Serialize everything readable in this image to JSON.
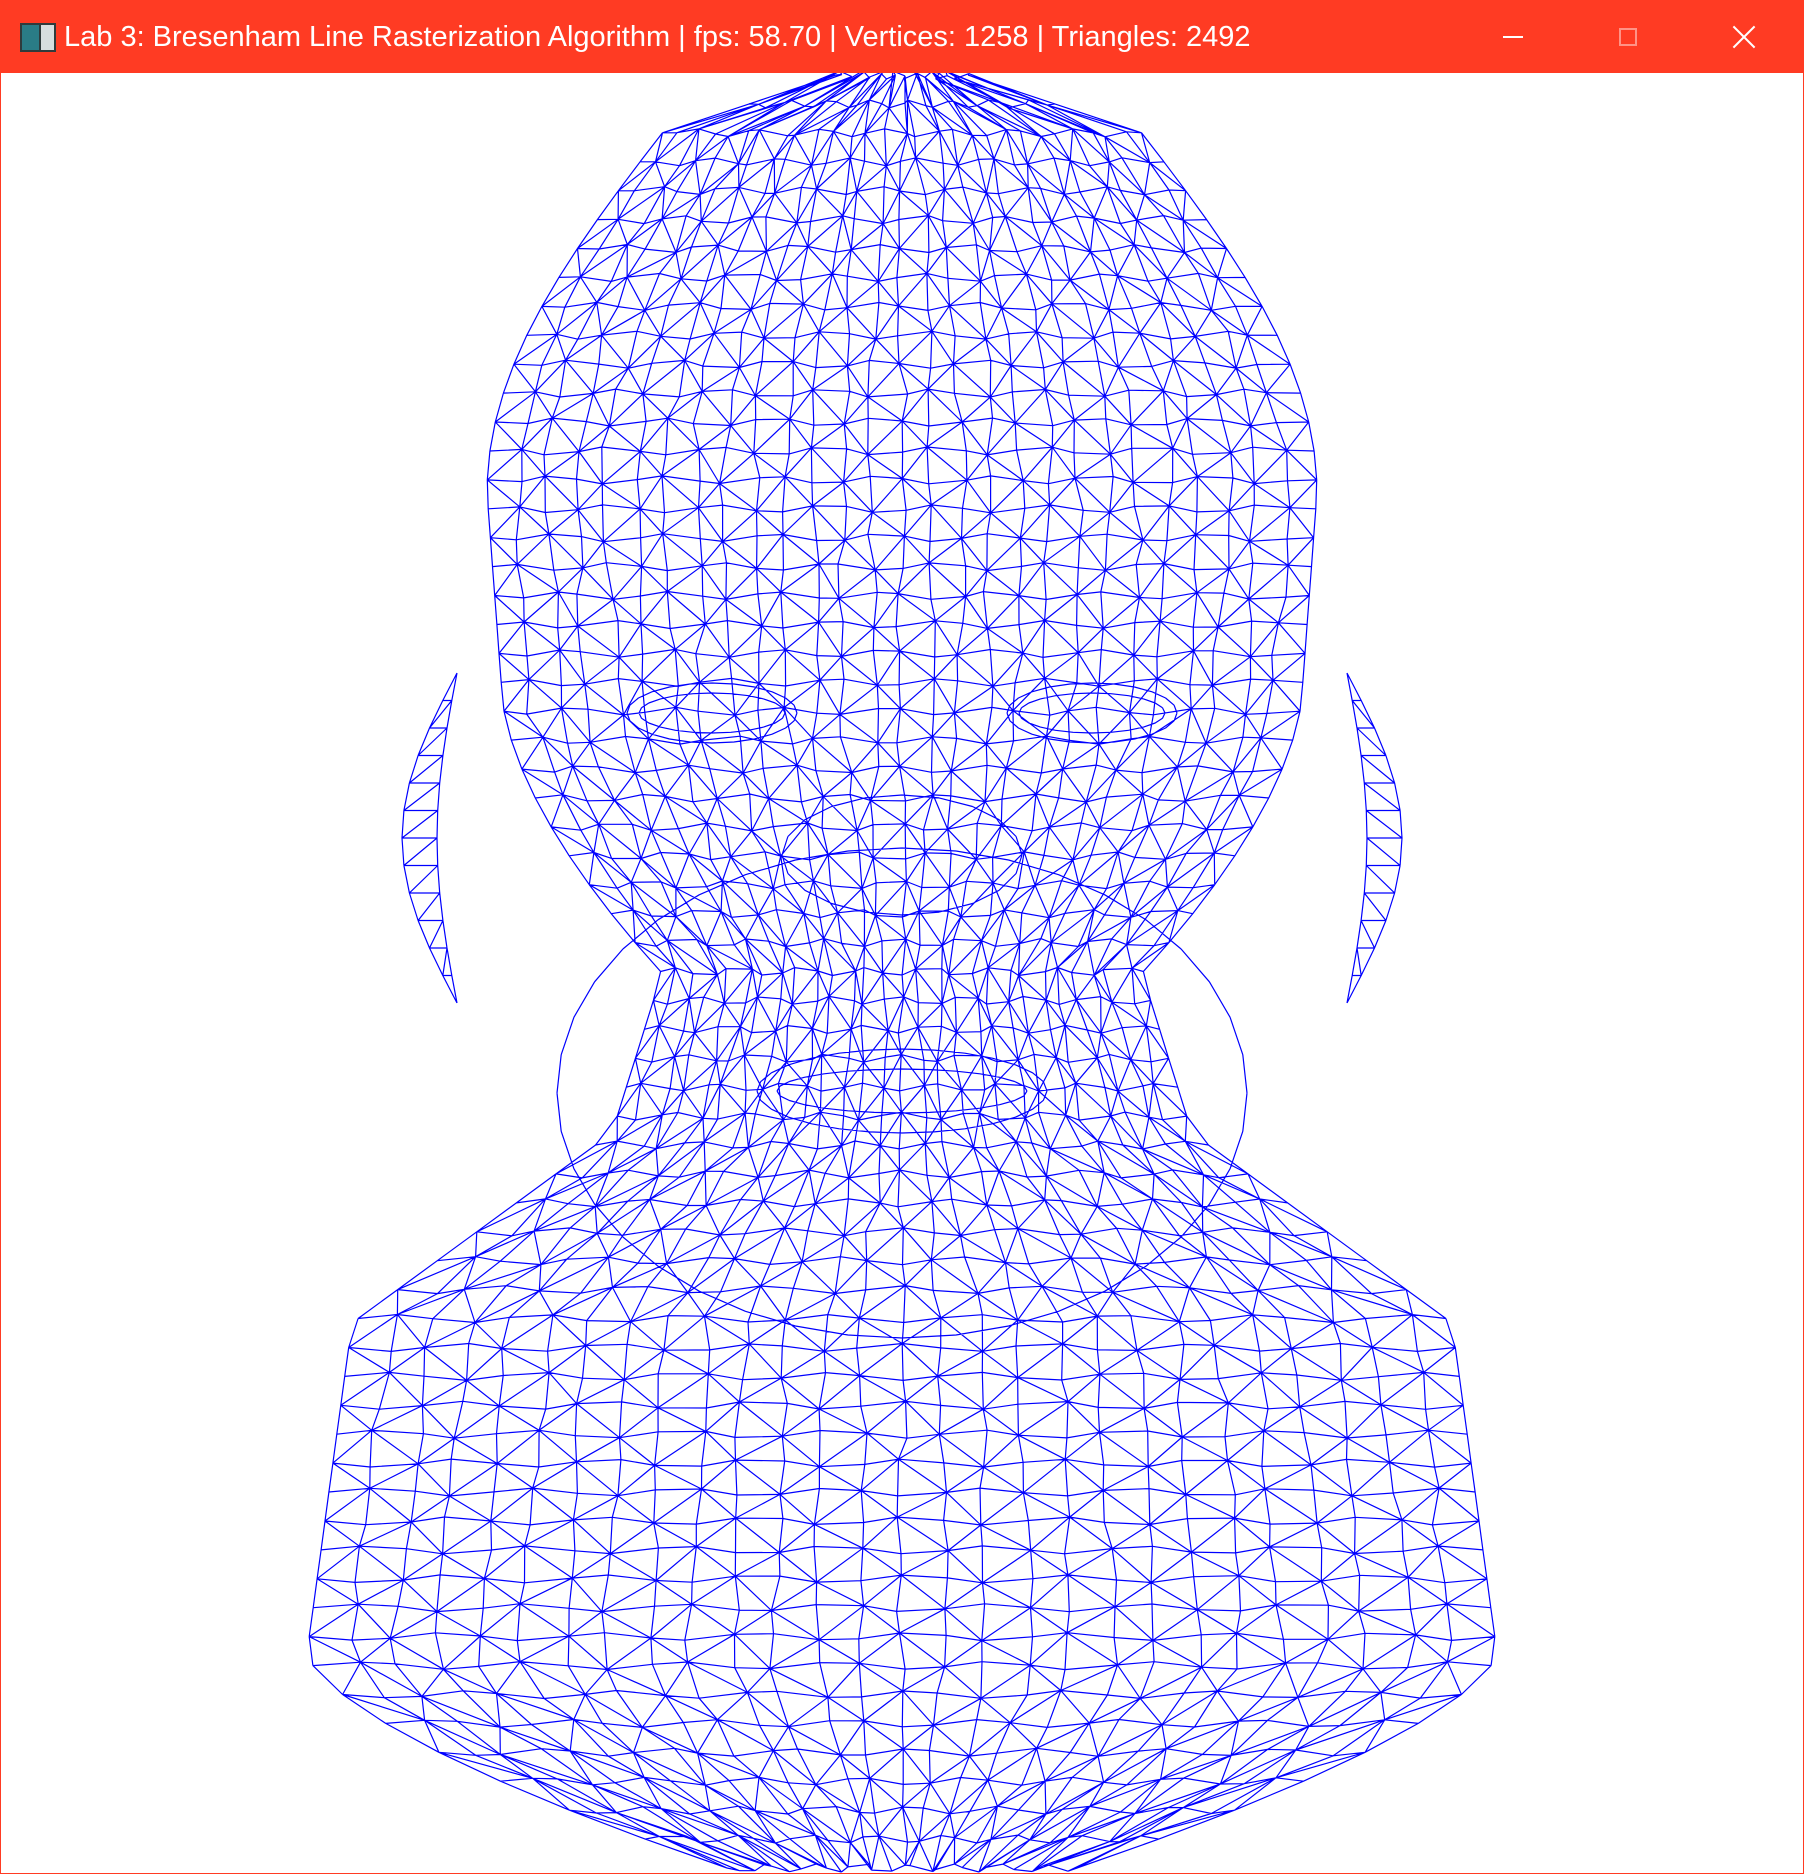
{
  "window": {
    "title": "Lab 3: Bresenham Line Rasterization Algorithm | fps: 58.70 | Vertices: 1258 | Triangles: 2492",
    "titlebar_color": "#ff3b23",
    "controls": {
      "minimize_icon": "minimize-icon",
      "maximize_icon": "maximize-icon",
      "close_icon": "close-icon"
    }
  },
  "viewport": {
    "background_color": "#ffffff",
    "wireframe_color": "#0000ff"
  }
}
